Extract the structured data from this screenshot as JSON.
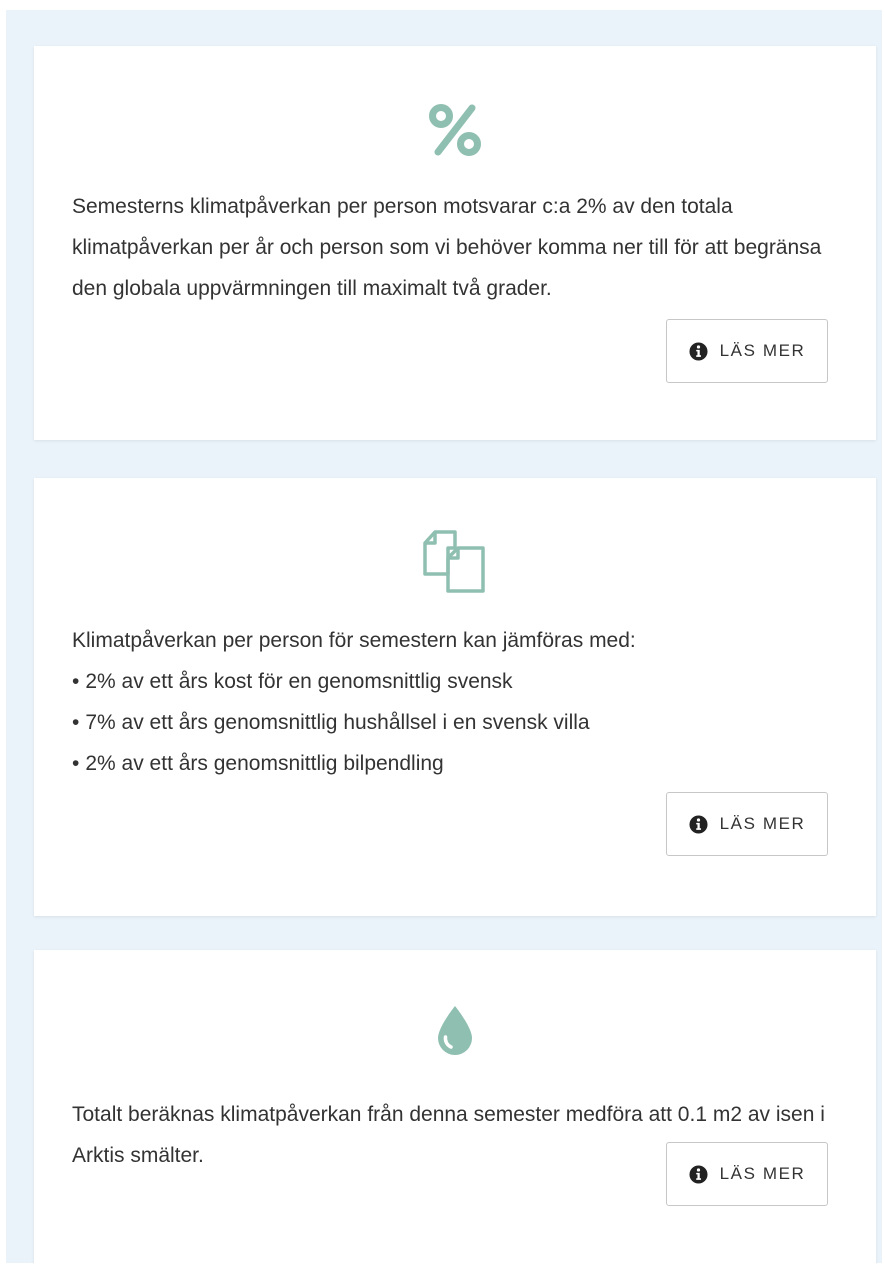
{
  "colors": {
    "page_background": "#e9f3f9",
    "card_background": "#ffffff",
    "icon_accent": "#8fbfb0",
    "text": "#333333",
    "button_border": "#c7c7c7"
  },
  "cards": [
    {
      "icon": "percent-icon",
      "text": "Semesterns klimatpåverkan per person motsvarar c:a 2% av den totala klimatpåverkan per år och person som vi behöver komma ner till för att begränsa den globala uppvärmningen till maximalt två grader.",
      "button": {
        "icon": "info-circle-icon",
        "label": "LÄS MER"
      }
    },
    {
      "icon": "copy-documents-icon",
      "intro": "Klimatpåverkan per person för semestern kan jämföras med:",
      "items": [
        "2% av ett års kost för en genomsnittlig svensk",
        "7% av ett års genomsnittlig hushållsel i en svensk villa",
        "2% av ett års genomsnittlig bilpendling"
      ],
      "button": {
        "icon": "info-circle-icon",
        "label": "LÄS MER"
      }
    },
    {
      "icon": "water-drop-icon",
      "text": "Totalt beräknas klimatpåverkan från denna semester medföra att 0.1 m2 av isen i Arktis smälter.",
      "button": {
        "icon": "info-circle-icon",
        "label": "LÄS MER"
      }
    }
  ]
}
